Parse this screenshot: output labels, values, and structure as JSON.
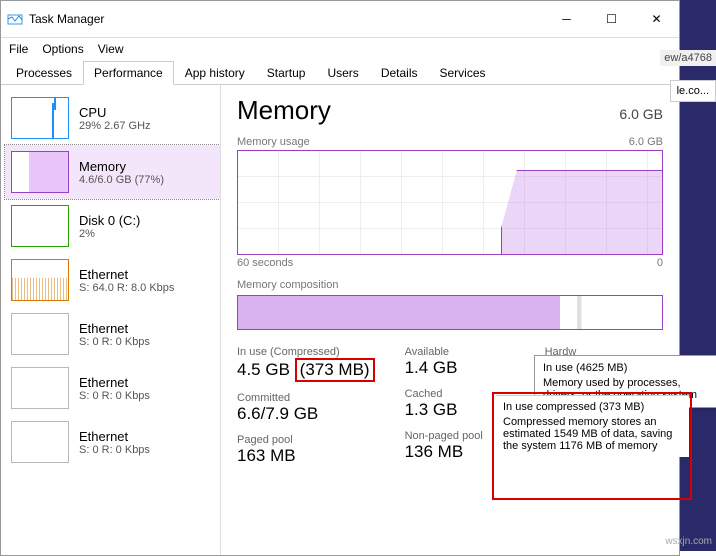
{
  "window": {
    "title": "Task Manager"
  },
  "menu": {
    "file": "File",
    "options": "Options",
    "view": "View"
  },
  "tabs": {
    "processes": "Processes",
    "performance": "Performance",
    "apphistory": "App history",
    "startup": "Startup",
    "users": "Users",
    "details": "Details",
    "services": "Services"
  },
  "sidebar": [
    {
      "name": "CPU",
      "sub": "29% 2.67 GHz"
    },
    {
      "name": "Memory",
      "sub": "4.6/6.0 GB (77%)"
    },
    {
      "name": "Disk 0 (C:)",
      "sub": "2%"
    },
    {
      "name": "Ethernet",
      "sub": "S: 64.0 R: 8.0 Kbps"
    },
    {
      "name": "Ethernet",
      "sub": "S: 0 R: 0 Kbps"
    },
    {
      "name": "Ethernet",
      "sub": "S: 0 R: 0 Kbps"
    },
    {
      "name": "Ethernet",
      "sub": "S: 0 R: 0 Kbps"
    }
  ],
  "main": {
    "title": "Memory",
    "capacity": "6.0 GB",
    "usage_label": "Memory usage",
    "usage_max": "6.0 GB",
    "time_left": "60 seconds",
    "time_right": "0",
    "comp_label": "Memory composition"
  },
  "stats": {
    "inuse_lbl": "In use (Compressed)",
    "inuse_val": "4.5 GB",
    "inuse_comp": "(373 MB)",
    "avail_lbl": "Available",
    "avail_val": "1.4 GB",
    "hw_lbl": "Hardw",
    "committed_lbl": "Committed",
    "committed_val": "6.6/7.9 GB",
    "cached_lbl": "Cached",
    "cached_val": "1.3 GB",
    "paged_lbl": "Paged pool",
    "paged_val": "163 MB",
    "nonpaged_lbl": "Non-paged pool",
    "nonpaged_val": "136 MB"
  },
  "tooltip1": {
    "title": "In use (4625 MB)",
    "body": "Memory used by processes, drivers, or the operating system"
  },
  "tooltip2": {
    "title": "In use compressed (373 MB)",
    "body": "Compressed memory stores an estimated 1549 MB of data, saving the system 1176 MB of memory"
  },
  "bg": {
    "url": "ew/a4768",
    "tab": "le.co..."
  },
  "watermark": "wsxjn.com"
}
